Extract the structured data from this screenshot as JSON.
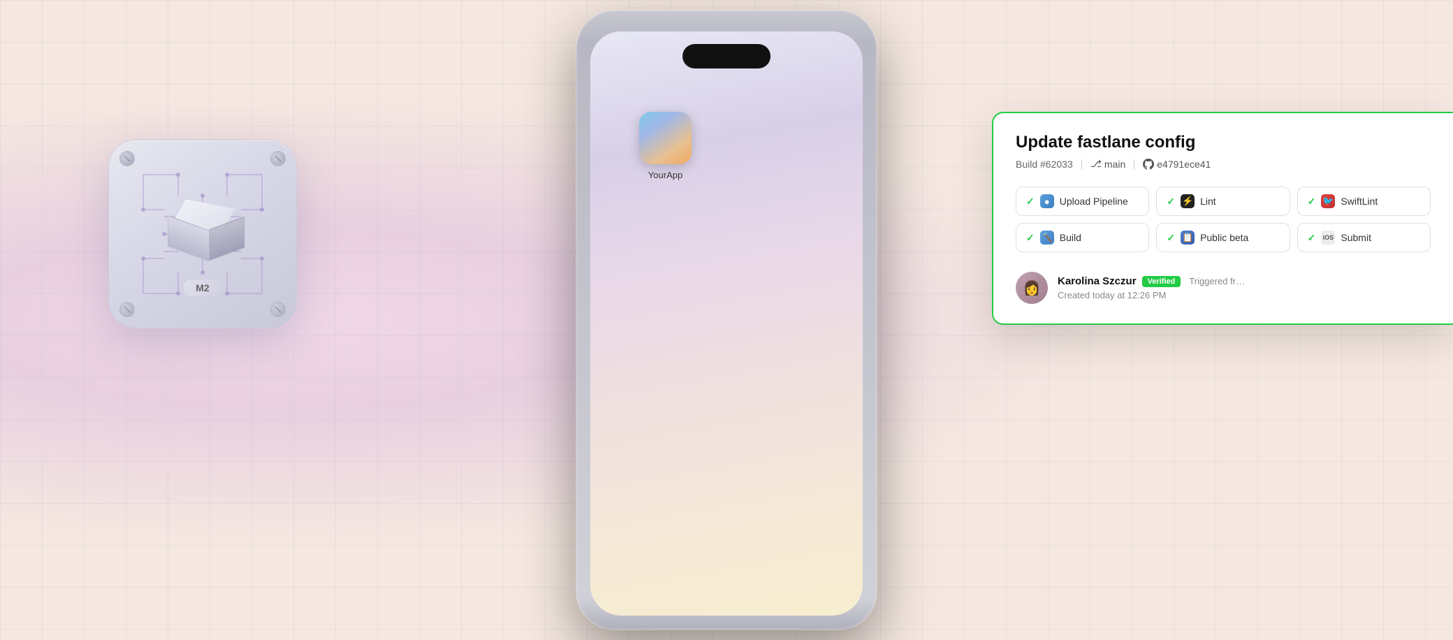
{
  "background": {
    "color1": "#f8ede5",
    "color2": "#fde8d0"
  },
  "chip": {
    "label": "M2",
    "screw_positions": [
      "tl",
      "tr",
      "bl",
      "br"
    ]
  },
  "phone": {
    "app_name": "YourApp"
  },
  "ci_card": {
    "title": "Update fastlane config",
    "build_number": "Build #62033",
    "branch": "main",
    "commit": "e4791ece41",
    "badges": [
      {
        "id": "upload",
        "label": "Upload Pipeline",
        "icon_type": "upload",
        "icon_text": "🔵"
      },
      {
        "id": "lint",
        "label": "Lint",
        "icon_type": "lint",
        "icon_text": "⚡"
      },
      {
        "id": "swiftlint",
        "label": "SwiftLint",
        "icon_type": "swift",
        "icon_text": "🔴"
      },
      {
        "id": "build",
        "label": "Build",
        "icon_type": "build",
        "icon_text": "🔨"
      },
      {
        "id": "beta",
        "label": "Public beta",
        "icon_type": "beta",
        "icon_text": "📋"
      },
      {
        "id": "submit",
        "label": "Submit",
        "icon_type": "ios",
        "icon_text": "iOS"
      }
    ],
    "author": {
      "name": "Karolina Szczur",
      "verified_label": "Verified",
      "created_text": "Created today at 12:26 PM",
      "triggered_text": "Triggered fr…",
      "avatar_emoji": "👩"
    }
  },
  "stripe_colors": [
    "#f4b060",
    "#f0a840",
    "#ec9830",
    "#f4a850",
    "#f0b060",
    "#e89830",
    "#f4b870",
    "#f0c070",
    "#eca840",
    "#f2b050",
    "#eea038",
    "#f0a830",
    "#eda030"
  ]
}
